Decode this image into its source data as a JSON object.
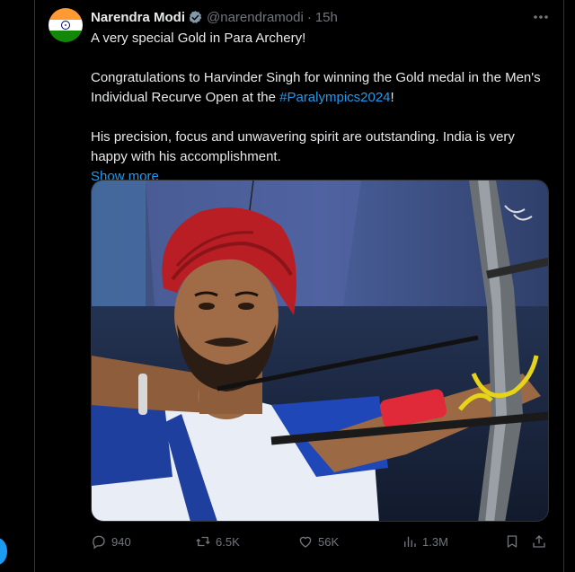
{
  "tweet": {
    "author_name": "Narendra Modi",
    "handle": "@narendramodi",
    "separator": "·",
    "time": "15h",
    "line1": "A very special Gold in Para Archery!",
    "line2_before": "Congratulations to Harvinder Singh for winning the Gold medal in the Men's Individual Recurve Open at the ",
    "hashtag": "#Paralympics2024",
    "line2_after": "!",
    "line3": "His precision, focus and unwavering spirit are outstanding. India is very happy with his accomplishment.",
    "show_more": "Show more"
  },
  "metrics": {
    "replies": "940",
    "reposts": "6.5K",
    "likes": "56K",
    "views": "1.3M"
  },
  "colors": {
    "background": "#000000",
    "text": "#e7e9ea",
    "muted": "#71767b",
    "accent": "#1d9bf0",
    "border": "#2f3336"
  },
  "icons": {
    "avatar": "india-flag-avatar",
    "verified": "verified-badge-icon",
    "more": "more-options-icon",
    "reply": "reply-icon",
    "repost": "repost-icon",
    "like": "heart-icon",
    "views": "views-icon",
    "bookmark": "bookmark-icon",
    "share": "share-icon"
  }
}
